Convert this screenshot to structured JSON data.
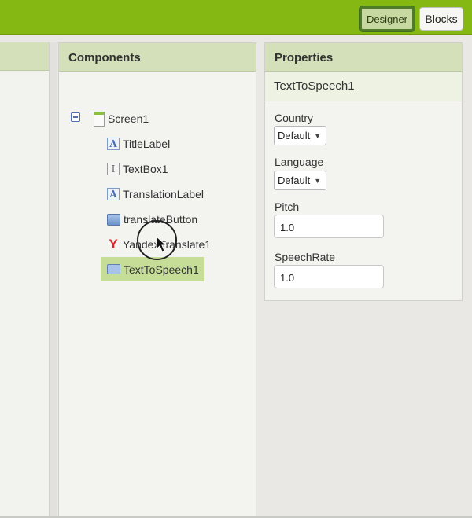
{
  "topbar": {
    "designer_label": "Designer",
    "blocks_label": "Blocks"
  },
  "components_panel": {
    "title": "Components",
    "tree": [
      {
        "label": "Screen1",
        "icon": "screen-icon"
      },
      {
        "label": "TitleLabel",
        "icon": "label-icon"
      },
      {
        "label": "TextBox1",
        "icon": "textbox-icon"
      },
      {
        "label": "TranslationLabel",
        "icon": "label-icon"
      },
      {
        "label": "translateButton",
        "icon": "button-icon"
      },
      {
        "label": "YandexTranslate1",
        "icon": "yandex-icon"
      },
      {
        "label": "TextToSpeech1",
        "icon": "speech-icon",
        "selected": true
      }
    ]
  },
  "properties_panel": {
    "title": "Properties",
    "component_name": "TextToSpeech1",
    "country": {
      "label": "Country",
      "value": "Default"
    },
    "language": {
      "label": "Language",
      "value": "Default"
    },
    "pitch": {
      "label": "Pitch",
      "value": "1.0"
    },
    "speech_rate": {
      "label": "SpeechRate",
      "value": "1.0"
    }
  },
  "colors": {
    "topbar": "#85b812",
    "panel_header": "#d3e0b9",
    "selected_row": "#c5dd97"
  }
}
